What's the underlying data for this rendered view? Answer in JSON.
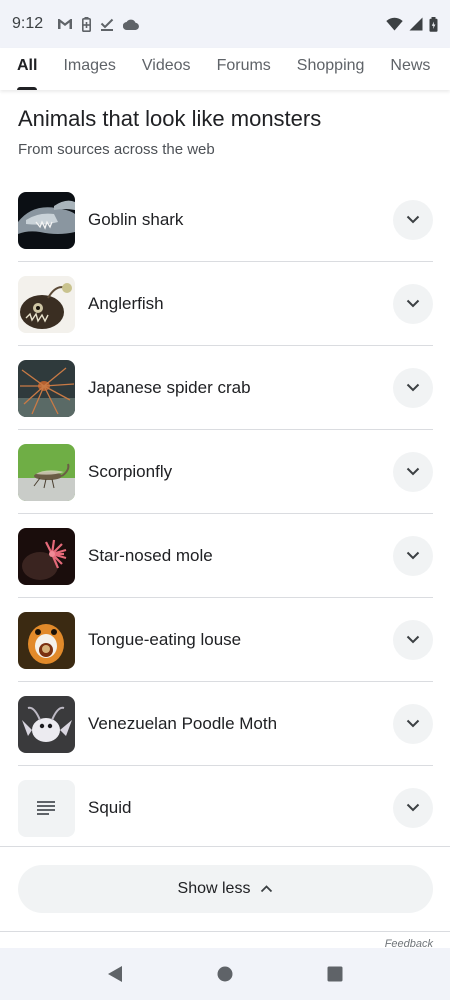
{
  "status_bar": {
    "time": "9:12",
    "left_icons": [
      "gmail-icon",
      "battery-saver-icon",
      "download-done-icon",
      "cloud-icon"
    ],
    "right_icons": [
      "wifi-icon",
      "signal-icon",
      "battery-icon"
    ]
  },
  "tabs": [
    {
      "label": "All",
      "active": true
    },
    {
      "label": "Images",
      "active": false
    },
    {
      "label": "Videos",
      "active": false
    },
    {
      "label": "Forums",
      "active": false
    },
    {
      "label": "Shopping",
      "active": false
    },
    {
      "label": "News",
      "active": false
    }
  ],
  "card": {
    "title": "Animals that look like monsters",
    "subtitle": "From sources across the web"
  },
  "items": [
    {
      "label": "Goblin shark",
      "thumb": "goblin-shark"
    },
    {
      "label": "Anglerfish",
      "thumb": "anglerfish"
    },
    {
      "label": "Japanese spider crab",
      "thumb": "spider-crab"
    },
    {
      "label": "Scorpionfly",
      "thumb": "scorpionfly"
    },
    {
      "label": "Star-nosed mole",
      "thumb": "star-nosed-mole"
    },
    {
      "label": "Tongue-eating louse",
      "thumb": "tongue-eating-louse"
    },
    {
      "label": "Venezuelan Poodle Moth",
      "thumb": "poodle-moth"
    },
    {
      "label": "Squid",
      "thumb": "text-document-icon"
    }
  ],
  "show_less": {
    "label": "Show less"
  },
  "feedback": {
    "label": "Feedback"
  },
  "colors": {
    "status_bar_bg": "#f1f3f9",
    "button_bg": "#f1f3f4",
    "text_primary": "#202124",
    "text_secondary": "#5f6368",
    "divider": "#dadce0"
  }
}
